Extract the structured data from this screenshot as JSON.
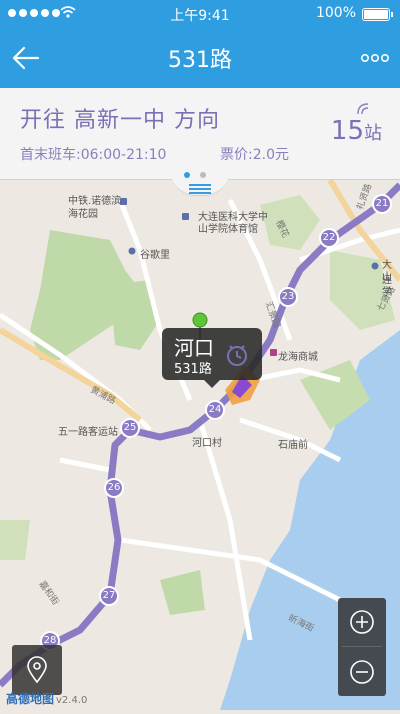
{
  "status_bar": {
    "time": "上午9:41",
    "battery": "100%"
  },
  "nav": {
    "title": "531路"
  },
  "panel": {
    "direction_prefix": "开往",
    "destination": "高新一中",
    "direction_suffix": "方向",
    "hours": "首末班车:06:00-21:10",
    "fare": "票价:2.0元",
    "stop_count": "15",
    "stop_unit": "站"
  },
  "callout": {
    "stop_name": "河口",
    "route": "531路"
  },
  "map": {
    "route_color": "#8a7bc4",
    "stops": [
      "21",
      "22",
      "23",
      "24",
      "25",
      "26",
      "27",
      "28"
    ],
    "labels": {
      "zhongtie": "中铁.诺德滨",
      "huayuan": "海花园",
      "dalian_med": "大连医科大学中",
      "sports": "山学院体育馆",
      "guge": "谷歌里",
      "longhai": "龙海商城",
      "huangpu": "黄浦路",
      "wuyi": "五一路客运站",
      "hekou_cun": "河口村",
      "shimiao": "石庙前",
      "qipan": "七贤路",
      "dalian_r1": "大连",
      "dalian_r2": "山学",
      "xinhai": "昕海街",
      "huijing": "汇景园",
      "yinghua": "樱花",
      "jiahe": "嘉和街",
      "lixian": "礼贤路"
    }
  },
  "logo": {
    "name": "高德地图",
    "version": "v2.4.0"
  }
}
